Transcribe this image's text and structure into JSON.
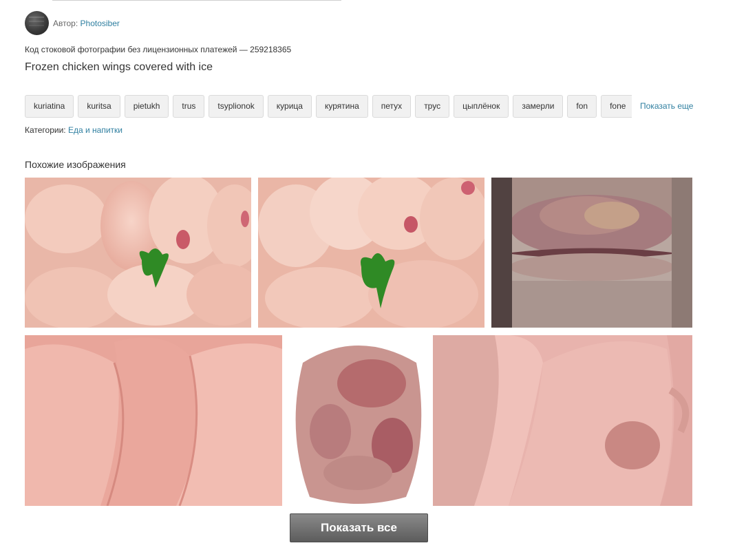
{
  "author": {
    "label": "Автор:",
    "name": "Photosiber"
  },
  "stock_code": "Код стоковой фотографии без лицензионных платежей — 259218365",
  "photo_title": "Frozen chicken wings covered with ice",
  "tags": [
    "kuriatina",
    "kuritsa",
    "pietukh",
    "trus",
    "tsyplionok",
    "курица",
    "курятина",
    "петух",
    "трус",
    "цыплёнок",
    "замерли",
    "fon",
    "fone"
  ],
  "show_more_label": "Показать еще",
  "categories": {
    "label": "Категории:",
    "value": "Еда и напитки"
  },
  "similar_label": "Похожие изображения",
  "show_all_label": "Показать все"
}
